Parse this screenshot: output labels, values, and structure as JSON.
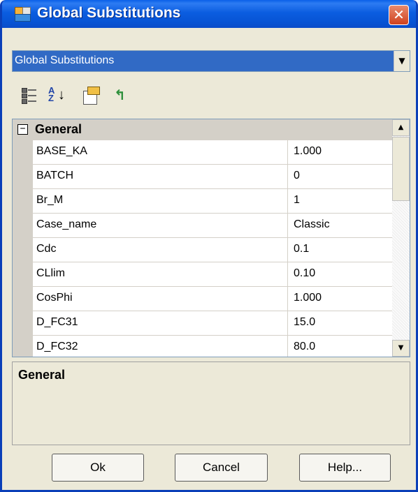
{
  "window": {
    "title": "Global Substitutions"
  },
  "selector": {
    "value": "Global Substitutions"
  },
  "toolbar": {
    "categorized_icon": "categorized-icon",
    "alphabetical_icon": "sort-az-icon",
    "properties_icon": "property-pages-icon",
    "events_icon": "events-icon"
  },
  "grid": {
    "category": "General",
    "rows": [
      {
        "name": "BASE_KA",
        "value": "1.000"
      },
      {
        "name": "BATCH",
        "value": "0"
      },
      {
        "name": "Br_M",
        "value": "1"
      },
      {
        "name": "Case_name",
        "value": "Classic"
      },
      {
        "name": "Cdc",
        "value": "0.1"
      },
      {
        "name": "CLlim",
        "value": "0.10"
      },
      {
        "name": "CosPhi",
        "value": "1.000"
      },
      {
        "name": "D_FC31",
        "value": "15.0"
      },
      {
        "name": "D_FC32",
        "value": "80.0"
      }
    ]
  },
  "help_panel": {
    "title": "General"
  },
  "buttons": {
    "ok": "Ok",
    "cancel": "Cancel",
    "help": "Help..."
  }
}
